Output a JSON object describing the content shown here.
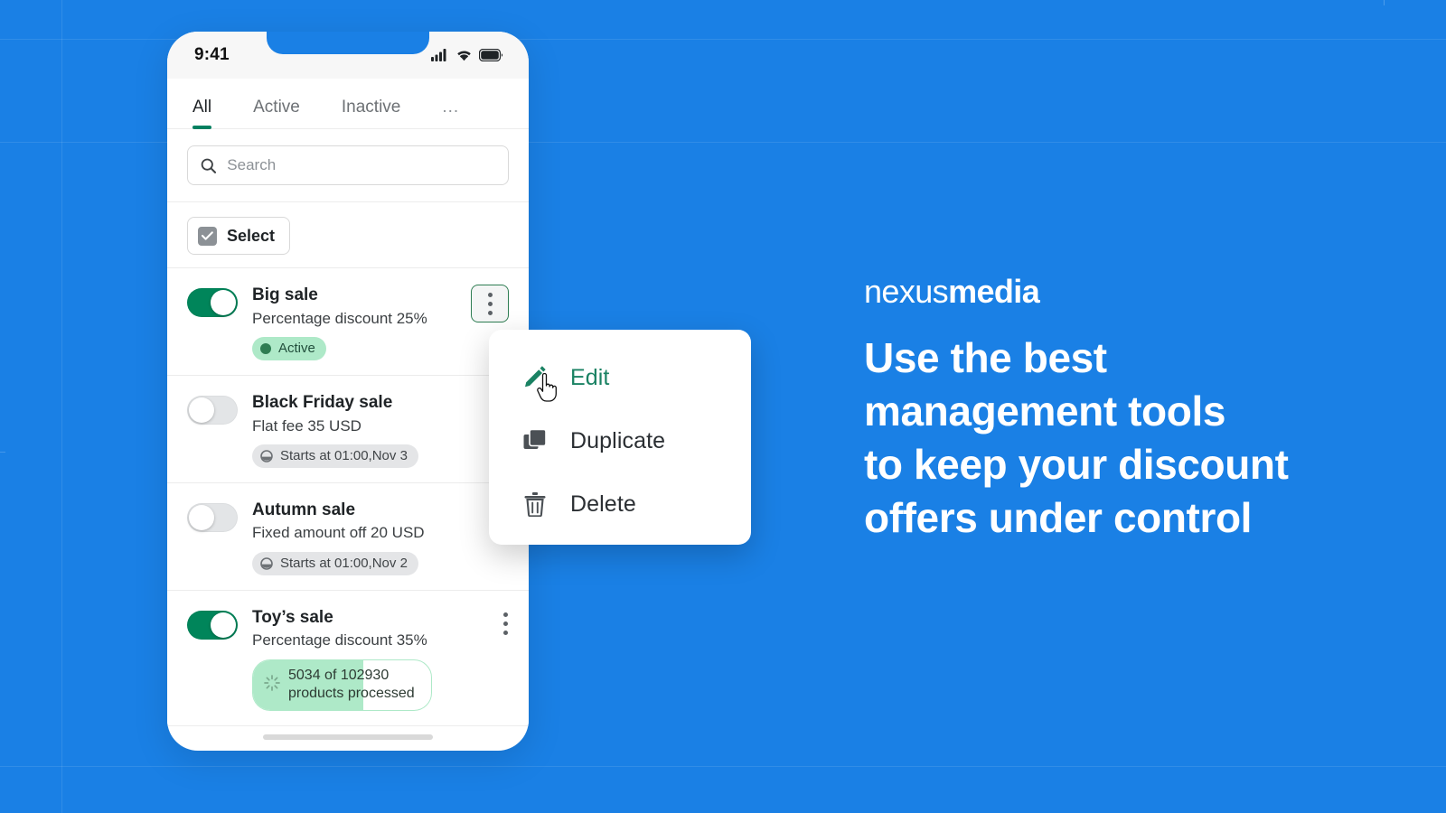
{
  "theme": {
    "background_blue": "#1a80e5",
    "accent_green": "#008060",
    "toggle_on_green": "#00855a",
    "badge_green_bg": "#aee9c8",
    "badge_grey_bg": "#e4e5e7",
    "menu_highlight_green": "#1a8263"
  },
  "phone": {
    "status_bar": {
      "time": "9:41",
      "cellular_icon": "cellular-signal-icon",
      "wifi_icon": "wifi-icon",
      "battery_icon": "battery-icon"
    },
    "tabs": [
      {
        "label": "All",
        "active": true
      },
      {
        "label": "Active",
        "active": false
      },
      {
        "label": "Inactive",
        "active": false
      },
      {
        "label": "...",
        "active": false
      }
    ],
    "search": {
      "placeholder": "Search",
      "value": "",
      "icon": "search-icon"
    },
    "select_button": {
      "label": "Select",
      "checkbox_icon": "checkbox-checked-icon",
      "checked": true
    },
    "rows": [
      {
        "title": "Big sale",
        "subtitle": "Percentage discount 25%",
        "toggle_on": true,
        "badge_kind": "status",
        "badge_text": "Active",
        "badge_icon": "status-dot-icon",
        "menu_open": true
      },
      {
        "title": "Black Friday sale",
        "subtitle": "Flat fee 35 USD",
        "toggle_on": false,
        "badge_kind": "schedule",
        "badge_text": "Starts at 01:00,Nov 3",
        "badge_icon": "partial-circle-icon",
        "menu_open": false
      },
      {
        "title": "Autumn sale",
        "subtitle": "Fixed amount off 20 USD",
        "toggle_on": false,
        "badge_kind": "schedule",
        "badge_text": "Starts at 01:00,Nov 2",
        "badge_icon": "partial-circle-icon",
        "menu_open": false
      },
      {
        "title": "Toy’s sale",
        "subtitle": "Percentage discount 35%",
        "toggle_on": true,
        "badge_kind": "progress",
        "badge_text_line1": "5034 of 102930",
        "badge_text_line2": "products processed",
        "badge_icon": "spinner-icon",
        "progress_percent": 62,
        "processed": 5034,
        "total": 102930,
        "menu_open": false
      }
    ]
  },
  "context_menu": {
    "items": [
      {
        "label": "Edit",
        "icon": "pencil-icon",
        "highlighted": true
      },
      {
        "label": "Duplicate",
        "icon": "copy-icon",
        "highlighted": false
      },
      {
        "label": "Delete",
        "icon": "trash-icon",
        "highlighted": false
      }
    ]
  },
  "promo": {
    "brand_light": "nexus",
    "brand_bold": "media",
    "headline_lines": [
      "Use the best",
      "management tools",
      "to keep your discount",
      "offers under control"
    ]
  }
}
